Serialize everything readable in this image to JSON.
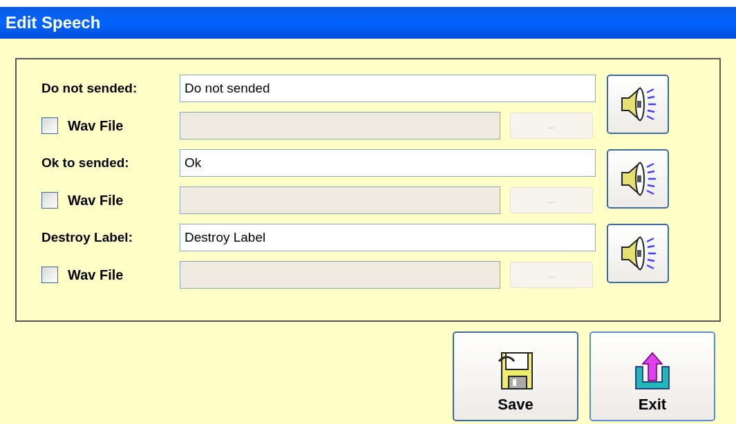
{
  "window": {
    "title": "Edit Speech"
  },
  "entries": [
    {
      "label": "Do not sended:",
      "value": "Do not sended",
      "wav": {
        "label": "Wav File",
        "checked": false
      },
      "browse": {
        "label": "...",
        "disabled": true
      }
    },
    {
      "label": "Ok to sended:",
      "value": "Ok",
      "wav": {
        "label": "Wav File",
        "checked": false
      },
      "browse": {
        "label": "...",
        "disabled": true
      }
    },
    {
      "label": "Destroy Label:",
      "value": "Destroy Label",
      "wav": {
        "label": "Wav File",
        "checked": false
      },
      "browse": {
        "label": "...",
        "disabled": true
      }
    }
  ],
  "buttons": [
    {
      "kind": "save",
      "label": "Save"
    },
    {
      "kind": "exit",
      "label": "Exit"
    }
  ]
}
